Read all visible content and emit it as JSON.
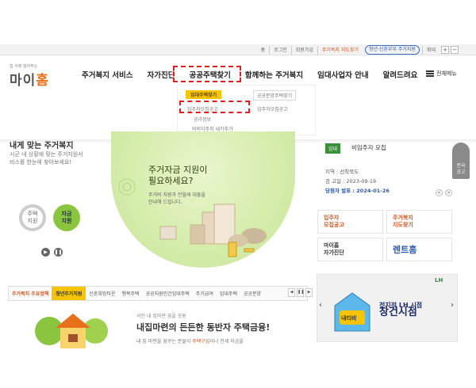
{
  "top_links": {
    "home_icon": "home-icon",
    "home": "홈",
    "login": "로그인",
    "signup": "회원가입",
    "map_link": "주거복지 지도찾기",
    "youth_pill": "청년·신혼부부 주거지원",
    "zoom_label": "확대",
    "zoom_in": "+",
    "zoom_out": "−"
  },
  "logo": {
    "tagline": "집 걱정 덜어주는",
    "name_pre": "마이",
    "name_post": "홈"
  },
  "gnb": [
    "주거복지 서비스",
    "자가진단",
    "공공주택찾기",
    "함께하는 주거복지",
    "임대사업자 안내",
    "알려드려요"
  ],
  "all_menu": "전체메뉴",
  "dropdown": {
    "col1": [
      "임대주택찾기",
      "임주자모집공고",
      "공가정보",
      "비비이주지 내가추가"
    ],
    "col2": [
      "공공분양주택찾기",
      "입주자모집공고"
    ]
  },
  "left": {
    "heading": "내게 맞는 주거복지",
    "desc": "시군 내 상황에 맞는 주거지원서비스를 한눈에 찾아보세요!",
    "circle1": "주택\n지원",
    "circle2": "자금\n지원",
    "play": "▶",
    "pause": "❚❚"
  },
  "promo": {
    "title_l1": "주거자금 지원이",
    "title_l2": "필요하세요?",
    "sub_l1": "주거비 지원과 전월세 대출을",
    "sub_l2": "안내해 드립니다."
  },
  "notice": {
    "tag": "임대",
    "title": "비임주자 모집",
    "location": "지역 : 선착북도",
    "notice_date": "공 고일 : 2023-09-19",
    "winner_date": "당첨자 발표 : 2024-01-26",
    "prev": "<",
    "next": ">"
  },
  "side_badge": "전국\n공고",
  "quick_links": [
    {
      "label": "입주자\n모집공고",
      "color": "#d2541a"
    },
    {
      "label": "주거복지\n지도찾기",
      "color": "#d2541a"
    },
    {
      "label": "마이홈\n자가진단",
      "color": "#333333"
    },
    {
      "label": "렌트홈",
      "color": "#2b5bb0"
    }
  ],
  "tabs": [
    "주거복지 주요정책",
    "청년주거지원",
    "신혼희망타운",
    "행복주택",
    "공공지원민간임대주택",
    "주거급여",
    "임대주택",
    "공공분양"
  ],
  "tabs_pager": [
    "◀",
    "❚❚",
    "▶"
  ],
  "loan": {
    "sub": "서민 내 집마련 꿈을 응원",
    "title": "내집마련의 든든한 동반자 주택금융!",
    "desc_pre": "내 집 마련을 꿈꾸는 분들이 ",
    "desc_hl": "주택구입",
    "desc_post": "이나 전세 자금을"
  },
  "lh_banner": {
    "prev": "‹",
    "next": "›",
    "badge": "내티비",
    "title_small": "전지적 LH 시점",
    "title": "창건시점",
    "logo": "LH"
  },
  "colors": {
    "accent_orange": "#e8701a",
    "highlight_yellow": "#f6c400",
    "green": "#8bc53f",
    "navy": "#1d2c6a",
    "annotation_red": "#e02020"
  }
}
